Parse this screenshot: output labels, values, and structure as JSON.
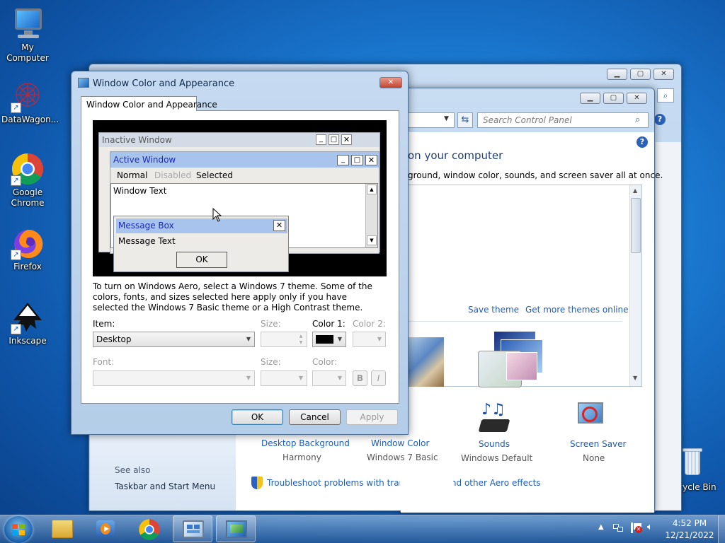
{
  "desktop": {
    "icons": [
      {
        "label": "My Computer"
      },
      {
        "label": "DataWagon..."
      },
      {
        "label": "Google Chrome"
      },
      {
        "label": "Firefox"
      },
      {
        "label": "Inkscape"
      }
    ],
    "recycle_bin": "Recycle Bin"
  },
  "control_panel": {
    "search_placeholder": "Search Control Panel",
    "heading": "on your computer",
    "subheading": "ground, window color, sounds, and screen saver all at once.",
    "save_theme": "Save theme",
    "get_more_themes": "Get more themes online",
    "bottom_items": [
      {
        "title": "Desktop Background",
        "value": "Harmony"
      },
      {
        "title": "Window Color",
        "value": "Windows 7 Basic"
      },
      {
        "title": "Sounds",
        "value": "Windows Default"
      },
      {
        "title": "Screen Saver",
        "value": "None"
      }
    ],
    "see_also": "See also",
    "taskbar_link": "Taskbar and Start Menu",
    "troubleshoot": "Troubleshoot problems with transparency and other Aero effects"
  },
  "dialog": {
    "title": "Window Color and Appearance",
    "tab": "Window Color and Appearance",
    "preview": {
      "inactive_title": "Inactive Window",
      "active_title": "Active Window",
      "menu_normal": "Normal",
      "menu_disabled": "Disabled",
      "menu_selected": "Selected",
      "window_text": "Window Text",
      "message_box_title": "Message Box",
      "message_text": "Message Text",
      "ok": "OK"
    },
    "description": "To turn on Windows Aero, select a Windows 7 theme.  Some of the colors, fonts, and sizes selected here apply only if you have selected the Windows 7 Basic theme or a High Contrast theme.",
    "item_label": "Item:",
    "item_value": "Desktop",
    "size_label": "Size:",
    "color1_label": "Color 1:",
    "color2_label": "Color 2:",
    "font_label": "Font:",
    "font_size_label": "Size:",
    "font_color_label": "Color:",
    "bold": "B",
    "italic": "I",
    "ok": "OK",
    "cancel": "Cancel",
    "apply": "Apply",
    "color1_value": "#000000"
  },
  "taskbar": {
    "time": "4:52 PM",
    "date": "12/21/2022"
  },
  "colors": {
    "link": "#1e5dbe",
    "active_caption": "#a9c4ec",
    "inactive_caption": "#d2dbe6"
  }
}
